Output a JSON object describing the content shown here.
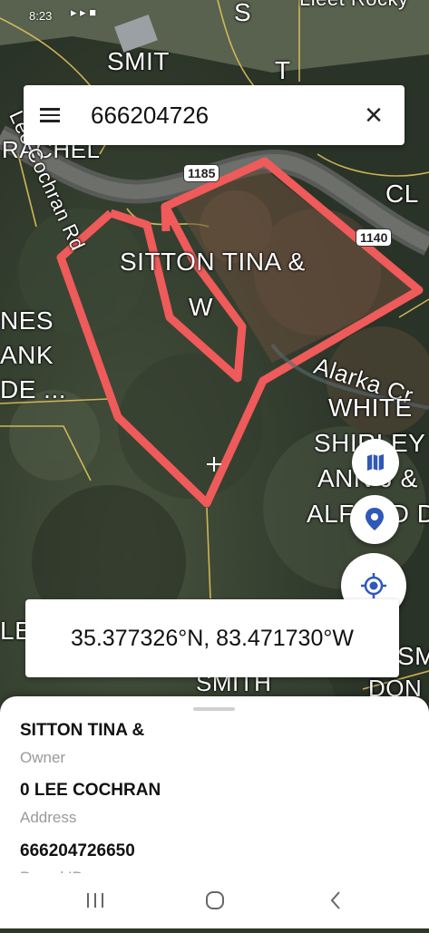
{
  "status_bar": {
    "time": "8:23"
  },
  "map": {
    "labels": {
      "s": "S",
      "smit": "SMIT",
      "t": "T",
      "rachel": "RACHEL",
      "road_name": "Lee Cochran Rd",
      "cl": "CL",
      "parcel_name_line1": "SITTON TINA &",
      "parcel_name_line2": "W",
      "nes": "NES",
      "ank": "ANK",
      "de": "DE ...",
      "creek": "Alarka Cr",
      "white": "WHITE",
      "shirley": "SHIRLEY",
      "ann": "ANN J &",
      "alfred": "ALFRED D",
      "smith": "SMITH",
      "le": "LE",
      "don": "DON",
      "sm": "SM",
      "top_right": "Lleet Rocky"
    },
    "road_shields": {
      "r1185": "1185",
      "r1140": "1140"
    }
  },
  "search": {
    "value": "666204726"
  },
  "coordinates": {
    "text": "35.377326°N, 83.471730°W"
  },
  "parcel": {
    "owner": "SITTON TINA &",
    "owner_label": "Owner",
    "address": "0 LEE COCHRAN",
    "address_label": "Address",
    "parcel_id": "666204726650",
    "parcel_id_label": "Parcel ID"
  },
  "icons": {
    "menu": "menu-icon",
    "close": "close-icon",
    "map_layers": "map-icon",
    "location_pin": "location-pin-icon",
    "my_location": "my-location-icon",
    "nav_recent": "recent-apps-icon",
    "nav_home": "home-icon",
    "nav_back": "back-icon"
  },
  "colors": {
    "parcel_outline": "#ef5a5a",
    "accent": "#2f58b8",
    "road_outline": "#e0c15a"
  }
}
